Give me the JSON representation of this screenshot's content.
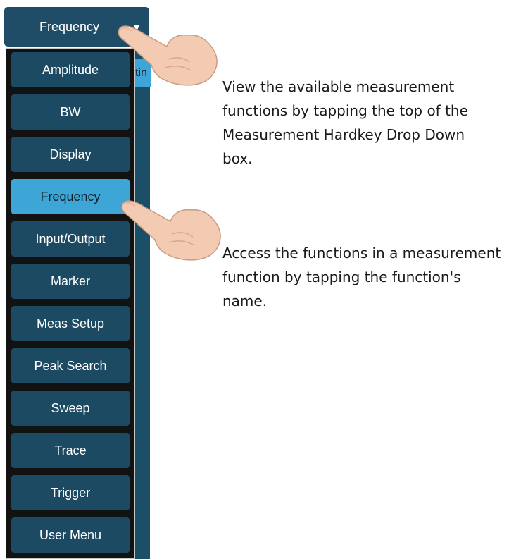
{
  "header": {
    "label": "Frequency",
    "caret": "▼"
  },
  "panel": {
    "partial_text": "tin"
  },
  "menu": {
    "items": [
      {
        "label": "Amplitude"
      },
      {
        "label": "BW"
      },
      {
        "label": "Display"
      },
      {
        "label": "Frequency",
        "selected": true
      },
      {
        "label": "Input/Output"
      },
      {
        "label": "Marker"
      },
      {
        "label": "Meas Setup"
      },
      {
        "label": "Peak Search"
      },
      {
        "label": "Sweep"
      },
      {
        "label": "Trace"
      },
      {
        "label": "Trigger"
      },
      {
        "label": "User Menu"
      }
    ]
  },
  "annotations": {
    "note1_lines": [
      "View the available measurement",
      "functions by tapping the top of the",
      "Measurement Hardkey Drop Down",
      "box."
    ],
    "note2_lines": [
      "Access the functions in a measurement",
      "function by tapping the function's",
      "name."
    ]
  },
  "colors": {
    "menu_item": "#1d4a63",
    "selected_item": "#3ea6d7",
    "menu_background": "#121212",
    "header": "#1f4d68"
  },
  "icons": [
    "pointing-hand-icon",
    "caret-down-icon"
  ]
}
